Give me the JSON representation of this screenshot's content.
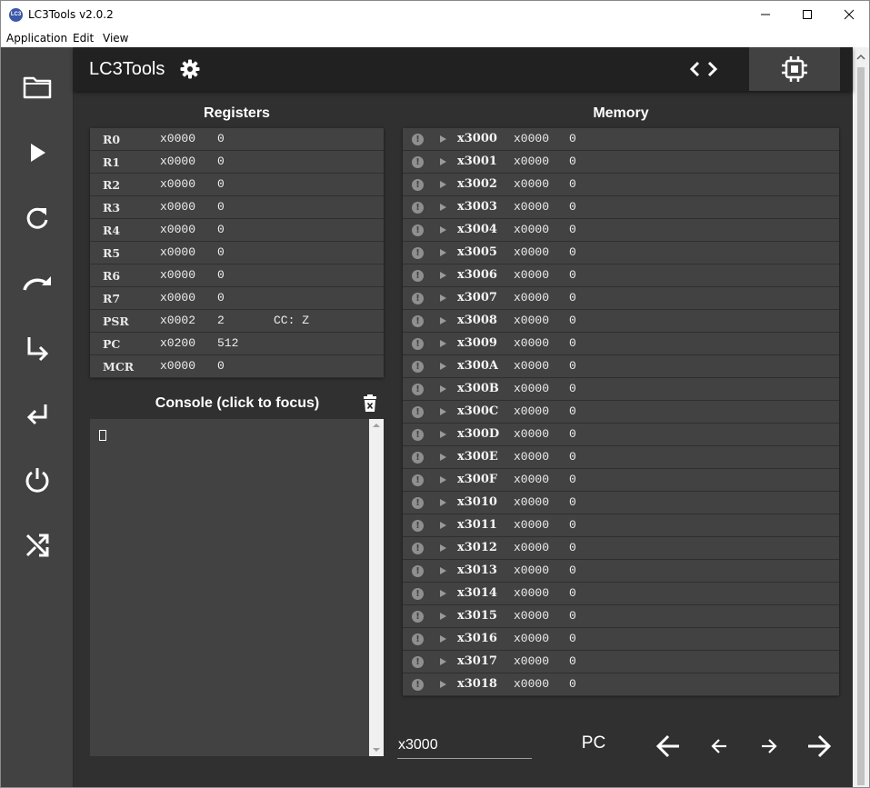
{
  "window": {
    "title": "LC3Tools v2.0.2",
    "icon_text": "LC3",
    "controls": [
      "minimize-icon",
      "maximize-icon",
      "close-icon"
    ]
  },
  "menu": {
    "items": [
      "Application",
      "Edit",
      "View"
    ]
  },
  "sidebar": {
    "items": [
      {
        "icon": "folder-icon",
        "name": "open-file"
      },
      {
        "icon": "play-icon",
        "name": "run"
      },
      {
        "icon": "refresh-icon",
        "name": "reload"
      },
      {
        "icon": "step-over-icon",
        "name": "step-over"
      },
      {
        "icon": "step-in-icon",
        "name": "step-in"
      },
      {
        "icon": "step-out-icon",
        "name": "step-out"
      },
      {
        "icon": "power-icon",
        "name": "reinitialize"
      },
      {
        "icon": "shuffle-icon",
        "name": "randomize"
      }
    ]
  },
  "header": {
    "title": "LC3Tools",
    "settings_icon": "gear-icon",
    "editor_icon": "code-icon",
    "simulator_icon": "chip-icon"
  },
  "registers": {
    "title": "Registers",
    "rows": [
      {
        "name": "R0",
        "hex": "x0000",
        "dec": "0",
        "extra": ""
      },
      {
        "name": "R1",
        "hex": "x0000",
        "dec": "0",
        "extra": ""
      },
      {
        "name": "R2",
        "hex": "x0000",
        "dec": "0",
        "extra": ""
      },
      {
        "name": "R3",
        "hex": "x0000",
        "dec": "0",
        "extra": ""
      },
      {
        "name": "R4",
        "hex": "x0000",
        "dec": "0",
        "extra": ""
      },
      {
        "name": "R5",
        "hex": "x0000",
        "dec": "0",
        "extra": ""
      },
      {
        "name": "R6",
        "hex": "x0000",
        "dec": "0",
        "extra": ""
      },
      {
        "name": "R7",
        "hex": "x0000",
        "dec": "0",
        "extra": ""
      },
      {
        "name": "PSR",
        "hex": "x0002",
        "dec": "2",
        "extra": "CC: Z"
      },
      {
        "name": "PC",
        "hex": "x0200",
        "dec": "512",
        "extra": ""
      },
      {
        "name": "MCR",
        "hex": "x0000",
        "dec": "0",
        "extra": ""
      }
    ]
  },
  "console": {
    "title": "Console (click to focus)",
    "clear_icon": "trash-icon",
    "content": ""
  },
  "memory": {
    "title": "Memory",
    "rows": [
      {
        "addr": "x3000",
        "hex": "x0000",
        "dec": "0"
      },
      {
        "addr": "x3001",
        "hex": "x0000",
        "dec": "0"
      },
      {
        "addr": "x3002",
        "hex": "x0000",
        "dec": "0"
      },
      {
        "addr": "x3003",
        "hex": "x0000",
        "dec": "0"
      },
      {
        "addr": "x3004",
        "hex": "x0000",
        "dec": "0"
      },
      {
        "addr": "x3005",
        "hex": "x0000",
        "dec": "0"
      },
      {
        "addr": "x3006",
        "hex": "x0000",
        "dec": "0"
      },
      {
        "addr": "x3007",
        "hex": "x0000",
        "dec": "0"
      },
      {
        "addr": "x3008",
        "hex": "x0000",
        "dec": "0"
      },
      {
        "addr": "x3009",
        "hex": "x0000",
        "dec": "0"
      },
      {
        "addr": "x300A",
        "hex": "x0000",
        "dec": "0"
      },
      {
        "addr": "x300B",
        "hex": "x0000",
        "dec": "0"
      },
      {
        "addr": "x300C",
        "hex": "x0000",
        "dec": "0"
      },
      {
        "addr": "x300D",
        "hex": "x0000",
        "dec": "0"
      },
      {
        "addr": "x300E",
        "hex": "x0000",
        "dec": "0"
      },
      {
        "addr": "x300F",
        "hex": "x0000",
        "dec": "0"
      },
      {
        "addr": "x3010",
        "hex": "x0000",
        "dec": "0"
      },
      {
        "addr": "x3011",
        "hex": "x0000",
        "dec": "0"
      },
      {
        "addr": "x3012",
        "hex": "x0000",
        "dec": "0"
      },
      {
        "addr": "x3013",
        "hex": "x0000",
        "dec": "0"
      },
      {
        "addr": "x3014",
        "hex": "x0000",
        "dec": "0"
      },
      {
        "addr": "x3015",
        "hex": "x0000",
        "dec": "0"
      },
      {
        "addr": "x3016",
        "hex": "x0000",
        "dec": "0"
      },
      {
        "addr": "x3017",
        "hex": "x0000",
        "dec": "0"
      },
      {
        "addr": "x3018",
        "hex": "x0000",
        "dec": "0"
      }
    ]
  },
  "memory_nav": {
    "jump_value": "x3000",
    "pc_label": "PC",
    "buttons": [
      "arrow-left-large-icon",
      "arrow-left-icon",
      "arrow-right-icon",
      "arrow-right-large-icon"
    ]
  },
  "colors": {
    "background": "#303030",
    "sidebar": "#424242",
    "header": "#212121",
    "table": "#424242",
    "text": "#ffffff"
  }
}
